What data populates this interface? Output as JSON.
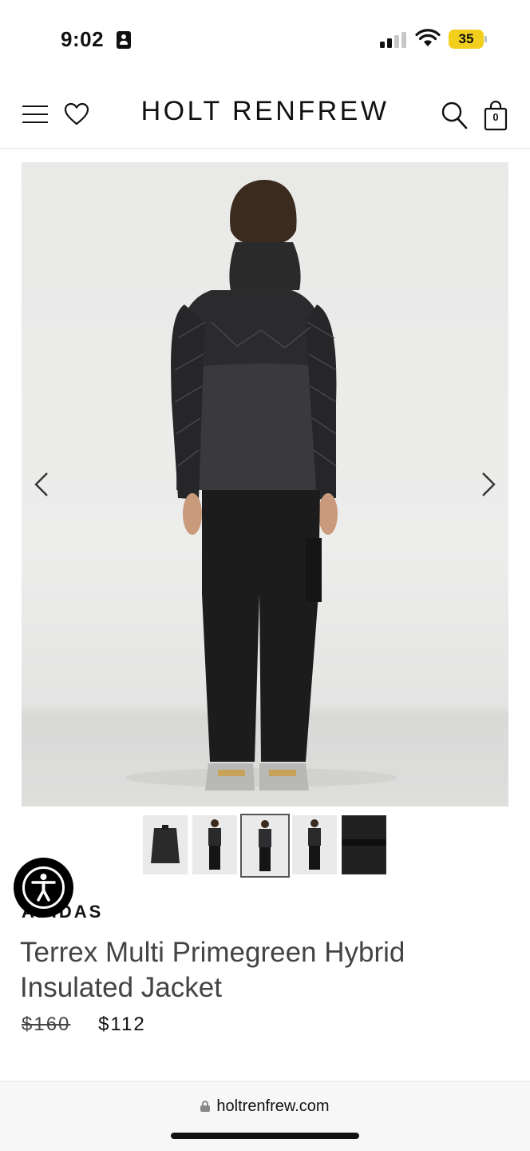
{
  "status_bar": {
    "time": "9:02",
    "battery": "35",
    "icons": [
      "contact-card-icon",
      "cellular-signal-icon",
      "wifi-icon",
      "battery-icon"
    ],
    "battery_color": "#f2cf1c"
  },
  "header": {
    "logo": "HOLT RENFREW",
    "bag_count": "0",
    "icons": [
      "menu-icon",
      "heart-icon",
      "search-icon",
      "shopping-bag-icon"
    ]
  },
  "gallery": {
    "image_alt": "Model wearing black hybrid insulated jacket and black cargo pants, back view",
    "thumbnail_count": 5,
    "active_thumbnail": 3,
    "icons": [
      "chevron-left-icon",
      "chevron-right-icon"
    ]
  },
  "accessibility": {
    "icon": "accessibility-icon"
  },
  "product": {
    "brand": "ADIDAS",
    "name": "Terrex Multi Primegreen Hybrid Insulated Jacket",
    "price_original": "$160",
    "price_sale": "$112"
  },
  "browser": {
    "url": "holtrenfrew.com",
    "icon": "lock-icon"
  }
}
